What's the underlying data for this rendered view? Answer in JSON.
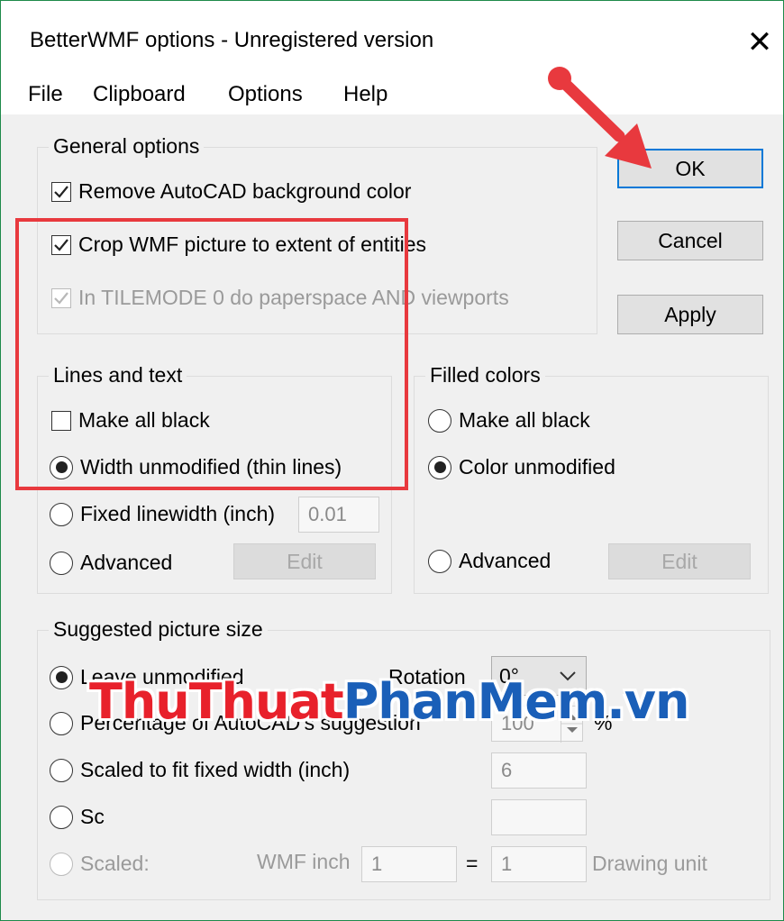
{
  "window": {
    "title": "BetterWMF options - Unregistered version",
    "close_label": "✕"
  },
  "menu": [
    "File",
    "Clipboard",
    "Options",
    "Help"
  ],
  "general": {
    "title": "General options",
    "remove_bg": "Remove AutoCAD background color",
    "crop": "Crop WMF picture to extent of entities",
    "tilemode": "In TILEMODE 0 do paperspace AND viewports"
  },
  "buttons": {
    "ok": "OK",
    "cancel": "Cancel",
    "apply": "Apply"
  },
  "lines": {
    "title": "Lines and text",
    "make_black": "Make all black",
    "width_unmod": "Width unmodified (thin lines)",
    "fixed": "Fixed linewidth (inch)",
    "fixed_value": "0.01",
    "advanced": "Advanced",
    "edit": "Edit"
  },
  "filled": {
    "title": "Filled colors",
    "make_black": "Make all black",
    "color_unmod": "Color unmodified",
    "advanced": "Advanced",
    "edit": "Edit"
  },
  "size": {
    "title": "Suggested picture size",
    "leave": "Leave unmodified",
    "rotation_label": "Rotation",
    "rotation_value": "0°",
    "percentage": "Percentage of AutoCAD's suggestion",
    "percentage_value": "100",
    "percent_sign": "%",
    "fit_width": "Scaled to fit fixed width (inch)",
    "fit_width_value": "6",
    "partial": "Sc",
    "scaled": "Scaled:",
    "wmf_inch": "WMF inch",
    "wmf_value": "1",
    "equals": "=",
    "drawing_value": "1",
    "drawing_unit": "Drawing unit"
  },
  "watermark": {
    "part1": "ThuThuat",
    "part2": "PhanMem",
    "part3": ".vn"
  },
  "colors": {
    "highlight": "#e8393e",
    "accent": "#0078d7",
    "watermark_red": "#e8212b",
    "watermark_blue": "#1a5fb8"
  }
}
